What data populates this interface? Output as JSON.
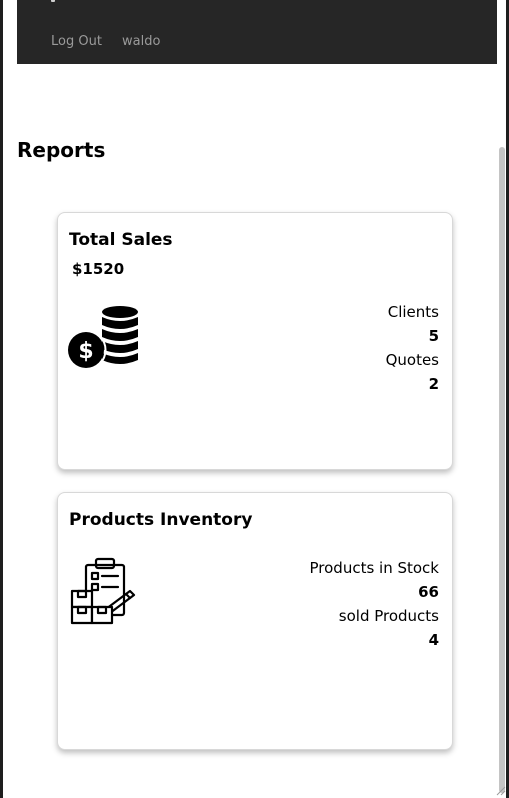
{
  "navbar": {
    "links": [
      {
        "label": "Log Out"
      },
      {
        "label": "waldo"
      }
    ]
  },
  "page": {
    "title": "Reports"
  },
  "cards": {
    "sales": {
      "title": "Total Sales",
      "amount": "$1520",
      "icon": "money-coins-icon",
      "stats": [
        {
          "label": "Clients",
          "value": "5"
        },
        {
          "label": "Quotes",
          "value": "2"
        }
      ]
    },
    "inventory": {
      "title": "Products Inventory",
      "icon": "inventory-clipboard-boxes-icon",
      "stats": [
        {
          "label": "Products in Stock",
          "value": "66"
        },
        {
          "label": "sold Products",
          "value": "4"
        }
      ]
    }
  },
  "colors": {
    "navbar_bg": "#262626",
    "nav_link": "#9a9a9a",
    "frame": "#1e1e1e"
  }
}
